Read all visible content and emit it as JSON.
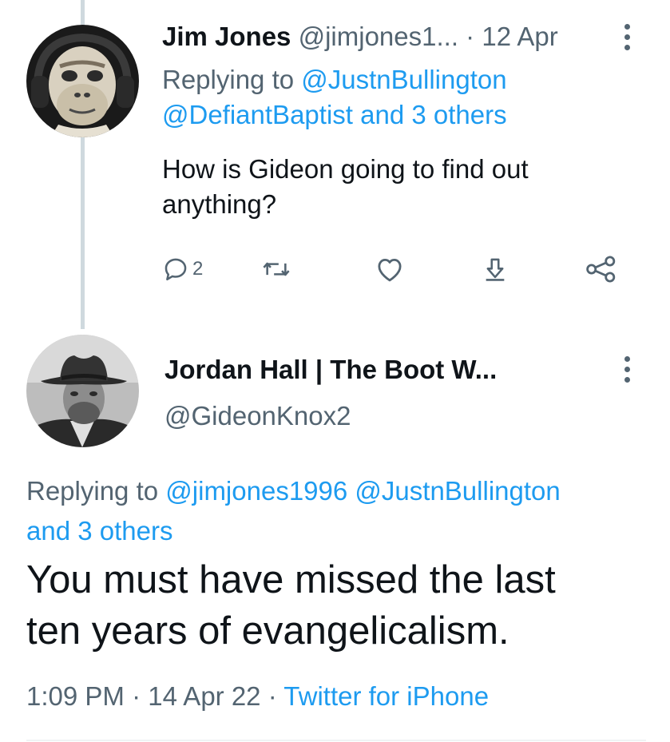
{
  "tweet1": {
    "author_name": "Jim Jones",
    "author_handle": "@jimjones1...",
    "separator": "·",
    "date": "12 Apr",
    "replying_prefix": "Replying to",
    "replying_to_1": "@JustnBullington",
    "replying_to_2": "@DefiantBaptist",
    "replying_and": "and",
    "replying_others": "3 others",
    "body_line1": "How is Gideon going to find out",
    "body_line2": "anything?",
    "reply_count": "2",
    "avatar_icon": "chimp-headphones-avatar"
  },
  "tweet2": {
    "author_name": "Jordan Hall | The Boot W...",
    "author_handle": "@GideonKnox2",
    "replying_prefix": "Replying to",
    "replying_to_1": "@jimjones1996",
    "replying_to_2": "@JustnBullington",
    "replying_and": "and",
    "replying_others": "3 others",
    "body_line1": "You must have missed the last",
    "body_line2": "ten years of evangelicalism.",
    "time": "1:09 PM",
    "date": "14 Apr 22",
    "separator": "·",
    "source": "Twitter for iPhone",
    "avatar_icon": "cowboy-hat-man-avatar"
  },
  "colors": {
    "text": "#0f1419",
    "muted": "#536471",
    "link": "#1d9bf0",
    "thread_line": "#cfd9de"
  }
}
